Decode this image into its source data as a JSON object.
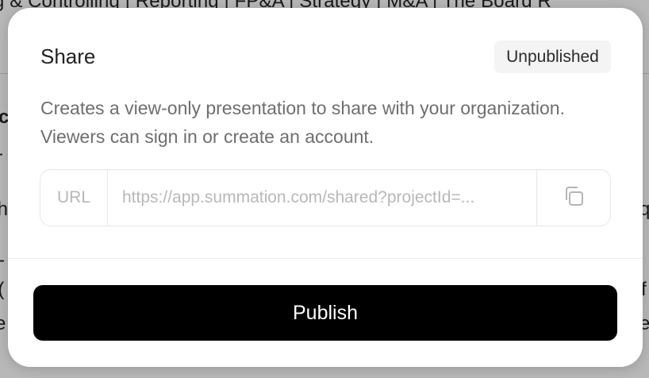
{
  "background": {
    "header_text": "g & Controlling | Reporting | FP&A | Strategy | M&A | The Board R",
    "fragments": [
      "c",
      "-",
      "th",
      "qu",
      "- ",
      "l(",
      "f",
      "e",
      "e"
    ]
  },
  "modal": {
    "title": "Share",
    "status_badge": "Unpublished",
    "description": "Creates a view-only presentation to share with your organization. Viewers can sign in or create an account.",
    "url_label": "URL",
    "url_value": "https://app.summation.com/shared?projectId=...",
    "copy_icon": "copy-icon",
    "publish_label": "Publish"
  },
  "colors": {
    "publish_bg": "#000000",
    "publish_text": "#ffffff",
    "badge_bg": "#f4f4f4",
    "muted_text": "#6e6e6e"
  }
}
